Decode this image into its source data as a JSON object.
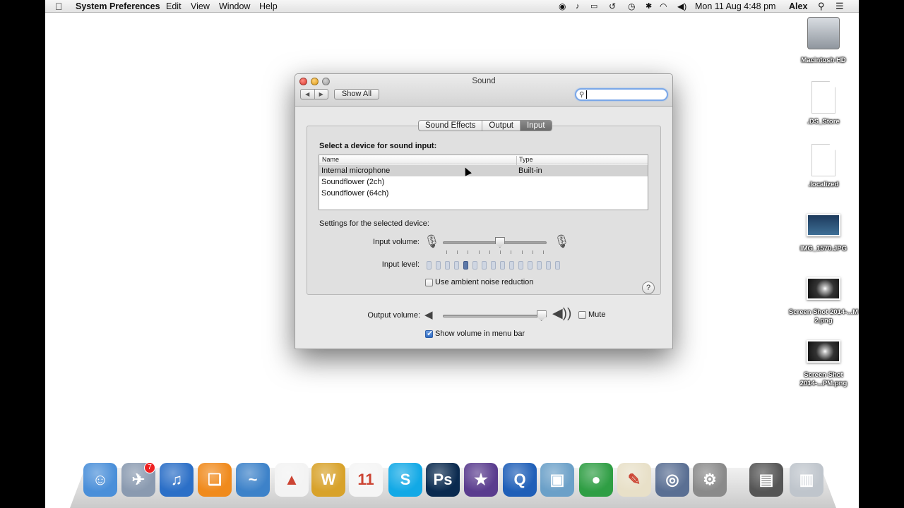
{
  "menubar": {
    "apple_icon": "apple-icon",
    "app_name": "System Preferences",
    "menus": [
      "Edit",
      "View",
      "Window",
      "Help"
    ],
    "clock": "Mon 11 Aug  4:48 pm",
    "user": "Alex",
    "status_icons": [
      "record-icon",
      "bell-icon",
      "airplay-icon",
      "time-machine-icon",
      "bluetooth-icon",
      "wifi-icon",
      "volume-icon",
      "search-icon",
      "list-icon"
    ]
  },
  "window": {
    "title": "Sound",
    "show_all": "Show All",
    "nav_back": "◀",
    "nav_forward": "▶",
    "search_placeholder": "",
    "tabs": [
      "Sound Effects",
      "Output",
      "Input"
    ],
    "active_tab": "Input",
    "device_label": "Select a device for sound input:",
    "table": {
      "columns": [
        "Name",
        "Type"
      ],
      "rows": [
        {
          "name": "Internal microphone",
          "type": "Built-in",
          "selected": true
        },
        {
          "name": "Soundflower (2ch)",
          "type": ""
        },
        {
          "name": "Soundflower (64ch)",
          "type": ""
        }
      ]
    },
    "settings_label": "Settings for the selected device:",
    "input_volume_label": "Input volume:",
    "input_volume": 0.55,
    "input_level_label": "Input level:",
    "input_level_segments": 15,
    "input_level_lit": 1,
    "noise_reduction_label": "Use ambient noise reduction",
    "noise_reduction": false,
    "help": "?",
    "output_volume_label": "Output volume:",
    "output_volume": 0.95,
    "mute_label": "Mute",
    "mute": false,
    "show_volume_label": "Show volume in menu bar",
    "show_volume": true
  },
  "desktop_icons": [
    {
      "label": "Macintosh HD",
      "kind": "hard-drive-icon"
    },
    {
      "label": ".DS_Store",
      "kind": "file-icon"
    },
    {
      "label": ".localized",
      "kind": "file-icon"
    },
    {
      "label": "IMG_1570.JPG",
      "kind": "image-icon"
    },
    {
      "label": "Screen Shot 2014-...M 2.png",
      "kind": "image-icon"
    },
    {
      "label": "Screen Shot 2014-...PM.png",
      "kind": "image-icon"
    }
  ],
  "dock": {
    "badge": "7",
    "apps": [
      {
        "name": "finder-icon",
        "color": "#4a8fd9",
        "glyph": "☺"
      },
      {
        "name": "mail-icon",
        "color": "#8a9ab0",
        "glyph": "✈"
      },
      {
        "name": "itunes-icon",
        "color": "#2b6fc7",
        "glyph": "♫"
      },
      {
        "name": "ibooks-icon",
        "color": "#f08a1c",
        "glyph": "❑"
      },
      {
        "name": "openoffice-icon",
        "color": "#3d82c9",
        "glyph": "~"
      },
      {
        "name": "vlc-icon",
        "color": "#f3f3f3",
        "glyph": "▲"
      },
      {
        "name": "fetch-icon",
        "color": "#d8a22a",
        "glyph": "W"
      },
      {
        "name": "calendar-icon",
        "color": "#f5f5f5",
        "glyph": "11"
      },
      {
        "name": "skype-icon",
        "color": "#12a9e6",
        "glyph": "S"
      },
      {
        "name": "photoshop-icon",
        "color": "#0a2a4f",
        "glyph": "Ps"
      },
      {
        "name": "imovie-icon",
        "color": "#5a3c8e",
        "glyph": "★"
      },
      {
        "name": "quicktime-icon",
        "color": "#1f5fb8",
        "glyph": "Q"
      },
      {
        "name": "iphoto-icon",
        "color": "#6ba0c8",
        "glyph": "▣"
      },
      {
        "name": "chrome-icon",
        "color": "#2f9e44",
        "glyph": "●"
      },
      {
        "name": "preview-icon",
        "color": "#e8e0c8",
        "glyph": "✎"
      },
      {
        "name": "compass-icon",
        "color": "#5a6f93",
        "glyph": "◎"
      },
      {
        "name": "system-preferences-icon",
        "color": "#8a8a8a",
        "glyph": "⚙"
      },
      {
        "name": "downloads-stack-icon",
        "color": "#555555",
        "glyph": "▤"
      },
      {
        "name": "trash-icon",
        "color": "#bfc5cc",
        "glyph": "▥"
      }
    ]
  }
}
